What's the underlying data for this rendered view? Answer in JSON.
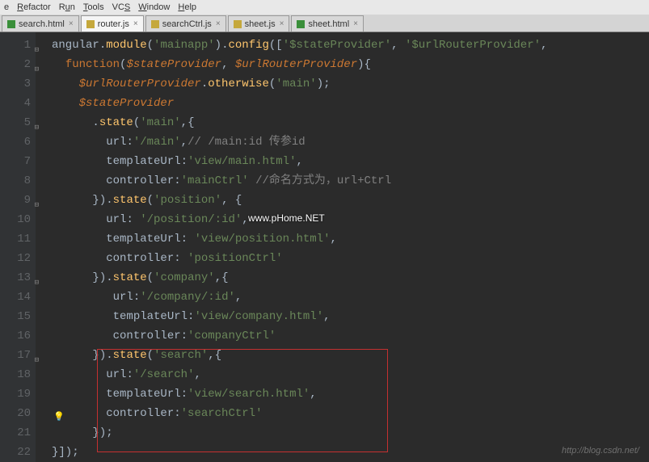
{
  "menu": {
    "items": [
      "e",
      "Refactor",
      "Run",
      "Tools",
      "VCS",
      "Window",
      "Help"
    ]
  },
  "tabs": [
    {
      "name": "search.html",
      "type": "html",
      "active": false
    },
    {
      "name": "router.js",
      "type": "js",
      "active": true
    },
    {
      "name": "searchCtrl.js",
      "type": "js",
      "active": false
    },
    {
      "name": "sheet.js",
      "type": "js",
      "active": false
    },
    {
      "name": "sheet.html",
      "type": "html",
      "active": false
    }
  ],
  "editor": {
    "line_count": 22,
    "highlighted_line": 20,
    "bulb_line": 20,
    "code": {
      "module_name": "mainapp",
      "inject1": "$stateProvider",
      "inject2": "$urlRouterProvider",
      "otherwise": "main",
      "states": [
        {
          "name": "main",
          "url": "/main",
          "templateUrl": "view/main.html",
          "controller": "mainCtrl",
          "url_comment": "// /main:id 传参id",
          "ctrl_comment": "//命名方式为，url+Ctrl"
        },
        {
          "name": "position",
          "url": "/position/:id",
          "templateUrl": "view/position.html",
          "controller": "positionCtrl"
        },
        {
          "name": "company",
          "url": "/company/:id",
          "templateUrl": "view/company.html",
          "controller": "companyCtrl"
        },
        {
          "name": "search",
          "url": "/search",
          "templateUrl": "view/search.html",
          "controller": "searchCtrl"
        }
      ]
    }
  },
  "watermark_text": "www.pHome.NET",
  "url_mark": "http://blog.csdn.net/"
}
